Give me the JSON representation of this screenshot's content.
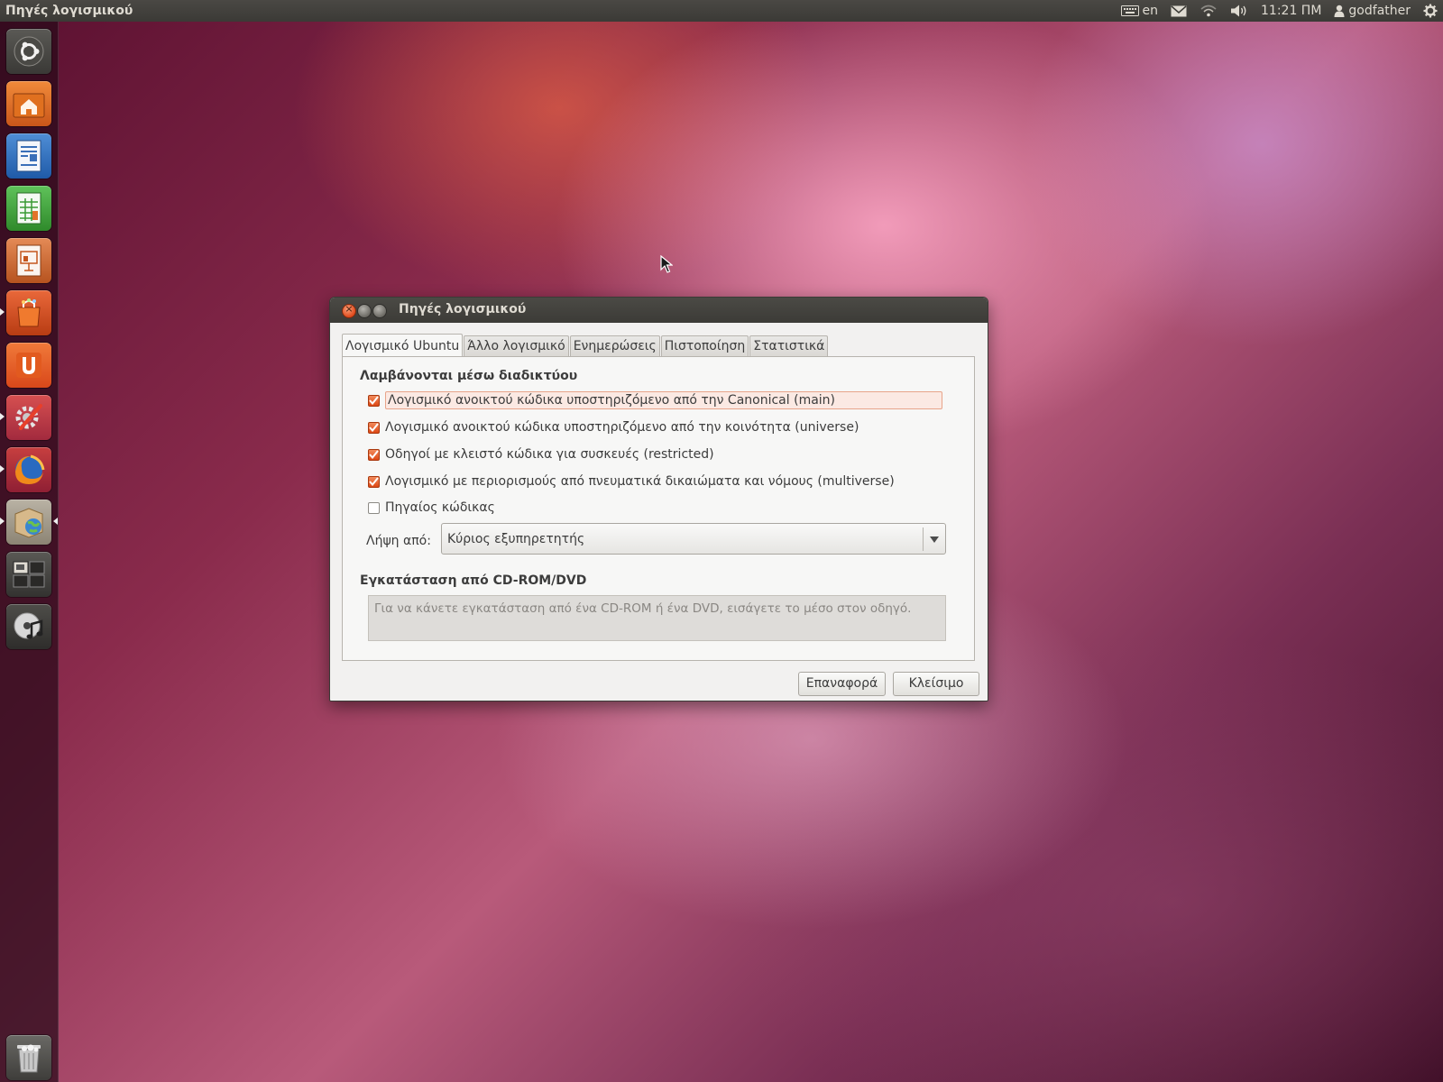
{
  "top_panel": {
    "app_title": "Πηγές λογισμικού",
    "keyboard_layout": "en",
    "clock": "11:21 ΠΜ",
    "user": "godfather"
  },
  "launcher": {
    "items": [
      {
        "name": "dash-home",
        "icon": "ubuntu-logo-icon"
      },
      {
        "name": "home-folder",
        "icon": "home-folder-icon"
      },
      {
        "name": "libreoffice-writer",
        "icon": "writer-icon"
      },
      {
        "name": "libreoffice-calc",
        "icon": "calc-icon"
      },
      {
        "name": "libreoffice-impress",
        "icon": "impress-icon"
      },
      {
        "name": "software-center",
        "icon": "shopping-bag-icon"
      },
      {
        "name": "ubuntu-one",
        "icon": "ubuntu-one-icon"
      },
      {
        "name": "system-settings",
        "icon": "settings-tools-icon"
      },
      {
        "name": "firefox",
        "icon": "firefox-icon"
      },
      {
        "name": "software-sources",
        "icon": "package-globe-icon"
      },
      {
        "name": "workspace-switcher",
        "icon": "workspaces-icon"
      },
      {
        "name": "music-player",
        "icon": "music-cd-icon"
      },
      {
        "name": "trash",
        "icon": "trash-icon"
      }
    ]
  },
  "dialog": {
    "title": "Πηγές λογισμικού",
    "tabs": [
      {
        "label": "Λογισμικό Ubuntu",
        "active": true
      },
      {
        "label": "Άλλο λογισμικό",
        "active": false
      },
      {
        "label": "Ενημερώσεις",
        "active": false
      },
      {
        "label": "Πιστοποίηση",
        "active": false
      },
      {
        "label": "Στατιστικά",
        "active": false
      }
    ],
    "internet_section": {
      "title": "Λαμβάνονται μέσω διαδικτύου",
      "options": [
        {
          "label": "Λογισμικό ανοικτού κώδικα υποστηριζόμενο από την Canonical (main)",
          "checked": true
        },
        {
          "label": "Λογισμικό ανοικτού κώδικα υποστηριζόμενο από την κοινότητα (universe)",
          "checked": true
        },
        {
          "label": "Οδηγοί με κλειστό κώδικα για συσκευές (restricted)",
          "checked": true
        },
        {
          "label": "Λογισμικό με περιορισμούς από πνευματικά δικαιώματα και νόμους (multiverse)",
          "checked": true
        },
        {
          "label": "Πηγαίος κώδικας",
          "checked": false
        }
      ],
      "download_from_label": "Λήψη από:",
      "download_from_value": "Κύριος εξυπηρετητής"
    },
    "cdrom_section": {
      "title": "Εγκατάσταση από  CD-ROM/DVD",
      "info": "Για να  κάνετε εγκατάσταση από ένα CD-ROM ή ένα DVD, εισάγετε το μέσο στον οδηγό."
    },
    "buttons": {
      "revert": "Επαναφορά",
      "close": "Κλείσιμο"
    }
  },
  "colors": {
    "accent_orange": "#dd4814",
    "panel_dark": "#3c3b37",
    "dialog_bg": "#f2f1f0"
  }
}
